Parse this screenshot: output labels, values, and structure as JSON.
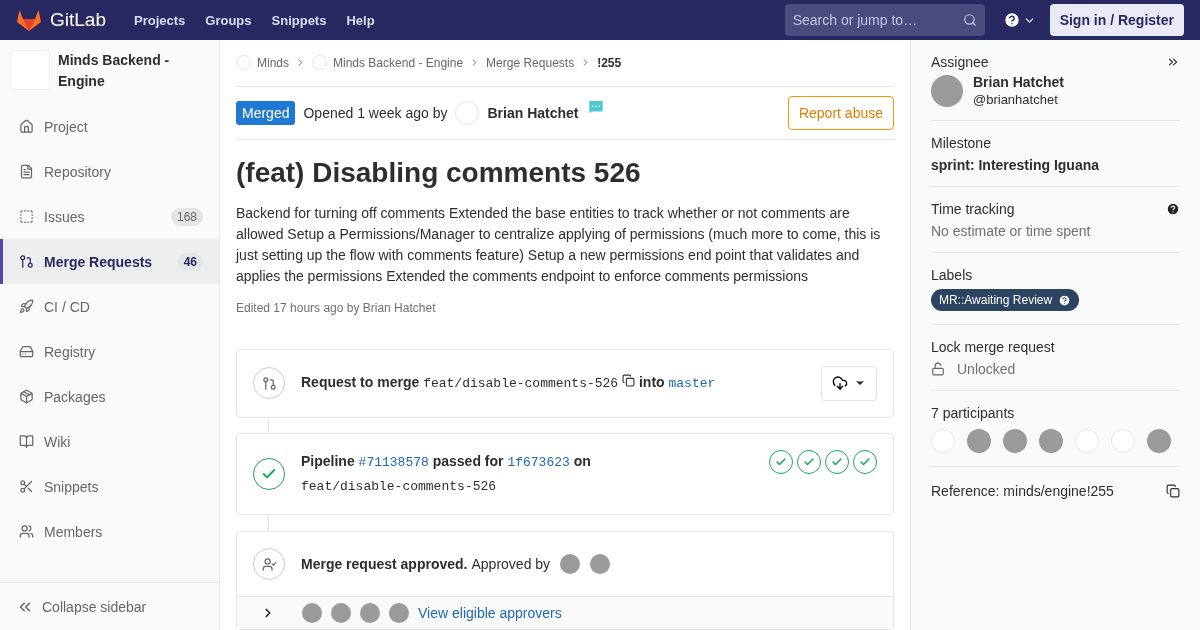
{
  "navbar": {
    "brand": "GitLab",
    "links": [
      "Projects",
      "Groups",
      "Snippets",
      "Help"
    ],
    "search": {
      "placeholder": "Search or jump to…"
    },
    "sign_in": "Sign in / Register"
  },
  "sidebar": {
    "project_name": "Minds Backend - Engine",
    "items": [
      {
        "label": "Project",
        "selected": false
      },
      {
        "label": "Repository",
        "selected": false
      },
      {
        "label": "Issues",
        "count": "168",
        "selected": false
      },
      {
        "label": "Merge Requests",
        "count": "46",
        "selected": true
      },
      {
        "label": "CI / CD",
        "selected": false
      },
      {
        "label": "Registry",
        "selected": false
      },
      {
        "label": "Packages",
        "selected": false
      },
      {
        "label": "Wiki",
        "selected": false
      },
      {
        "label": "Snippets",
        "selected": false
      },
      {
        "label": "Members",
        "selected": false
      }
    ],
    "collapse": "Collapse sidebar"
  },
  "breadcrumbs": [
    {
      "label": "Minds",
      "avatar": true,
      "current": false
    },
    {
      "label": "Minds Backend - Engine",
      "avatar": true,
      "current": false
    },
    {
      "label": "Merge Requests",
      "avatar": false,
      "current": false
    },
    {
      "label": "!255",
      "avatar": false,
      "current": true
    }
  ],
  "header": {
    "status": "Merged",
    "opened": "Opened 1 week ago by",
    "author": "Brian Hatchet",
    "report": "Report abuse"
  },
  "title": "(feat) Disabling comments 526",
  "description": "Backend for turning off comments Extended the base entities to track whether or not comments are allowed Setup a Permissions/Manager to centralize applying of permissions (much more to come, this is just setting up the flow with comments feature) Setup a new permissions end point that validates and applies the permissions Extended the comments endpoint to enforce comments permissions",
  "edited": "Edited 17 hours ago by Brian Hatchet",
  "merge_widget": {
    "prefix": "Request to merge",
    "source": "feat/disable-comments-526",
    "into": "into",
    "target": "master"
  },
  "pipeline": {
    "label": "Pipeline",
    "id": "#71138578",
    "passed_for": "passed for",
    "commit": "1f673623",
    "on": "on",
    "branch": "feat/disable-comments-526",
    "stages": [
      {
        "passed": true
      },
      {
        "passed": true
      },
      {
        "passed": true
      },
      {
        "passed": true
      }
    ]
  },
  "approval": {
    "title": "Merge request approved.",
    "approved_by": "Approved by",
    "approvers": [
      {
        "kind": "photo"
      },
      {
        "kind": "photo"
      }
    ],
    "eligible": [
      {
        "kind": "photo"
      },
      {
        "kind": "photo"
      },
      {
        "kind": "photo"
      },
      {
        "kind": "photo"
      }
    ],
    "eligible_link": "View eligible approvers"
  },
  "right": {
    "assignee_label": "Assignee",
    "assignee_name": "Brian Hatchet",
    "assignee_handle": "@brianhatchet",
    "milestone_label": "Milestone",
    "milestone": "sprint: Interesting Iguana",
    "time_label": "Time tracking",
    "time_value": "No estimate or time spent",
    "labels_label": "Labels",
    "labels": [
      {
        "text": "MR::Awaiting Review",
        "color": "#2c4361"
      }
    ],
    "lock_label": "Lock merge request",
    "lock_value": "Unlocked",
    "participants_label": "7 participants",
    "participants": [
      {
        "kind": "blank"
      },
      {
        "kind": "photo"
      },
      {
        "kind": "photo"
      },
      {
        "kind": "photo"
      },
      {
        "kind": "blank"
      },
      {
        "kind": "blank"
      },
      {
        "kind": "photo"
      }
    ],
    "reference": "Reference: minds/engine!255"
  }
}
